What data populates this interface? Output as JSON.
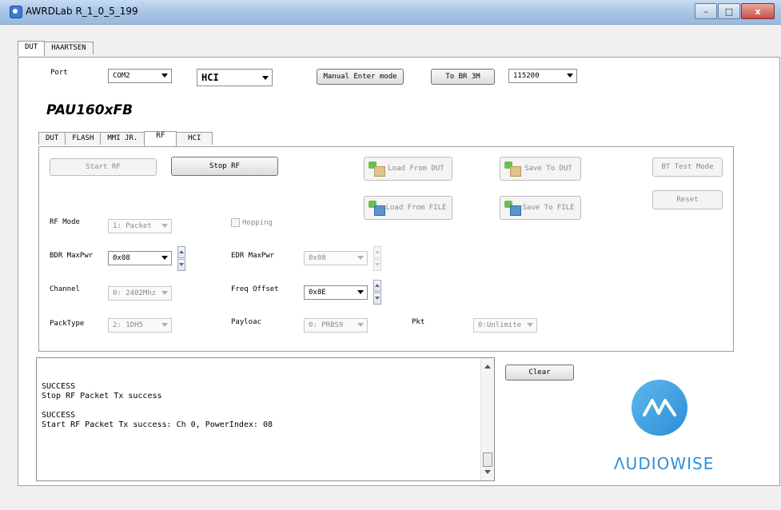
{
  "window": {
    "title": "AWRDLab R_1_0_5_199",
    "minimize": "–",
    "maximize": "□",
    "close": "x"
  },
  "outer_tabs": [
    "DUT",
    "HAARTSEN"
  ],
  "connection": {
    "port_label": "Port",
    "port_value": "COM2",
    "mode_value": "HCI",
    "manual_btn": "Manual Enter mode",
    "to_br_btn": "To BR 3M",
    "baud_value": "115200"
  },
  "model": "PAU160xFB",
  "inner_tabs": [
    "DUT",
    "FLASH",
    "MMI JR.",
    "RF",
    "HCI"
  ],
  "rf": {
    "start_rf": "Start RF",
    "stop_rf": "Stop RF",
    "load_from_dut": "Load From DUT",
    "save_to_dut": "Save To DUT",
    "load_from_file": "Load From FILE",
    "save_to_file": "Save To FILE",
    "bt_test_mode": "BT Test Mode",
    "reset": "Reset",
    "rf_mode_label": "RF Mode",
    "rf_mode_value": "1: Packet",
    "hopping_label": "Hopping",
    "bdr_label": "BDR MaxPwr",
    "bdr_value": "0x08",
    "edr_label": "EDR MaxPwr",
    "edr_value": "0x08",
    "channel_label": "Channel",
    "channel_value": "0: 2402Mhz",
    "freq_label": "Freq Offset",
    "freq_value": "0x8E",
    "packtype_label": "PackType",
    "packtype_value": "2: 1DH5",
    "payload_label": "Payloac",
    "payload_value": "0: PRBS9",
    "pkt_label": "Pkt",
    "pkt_value": "0:Unlimite"
  },
  "log": {
    "text": "SUCCESS\nStop RF Packet Tx success\n\nSUCCESS\nStart RF Packet Tx success: Ch 0, PowerIndex: 08",
    "clear_btn": "Clear"
  },
  "logo": {
    "text": "ΛUDIOWISE"
  },
  "colors": {
    "accent": "#2f8fd8"
  }
}
